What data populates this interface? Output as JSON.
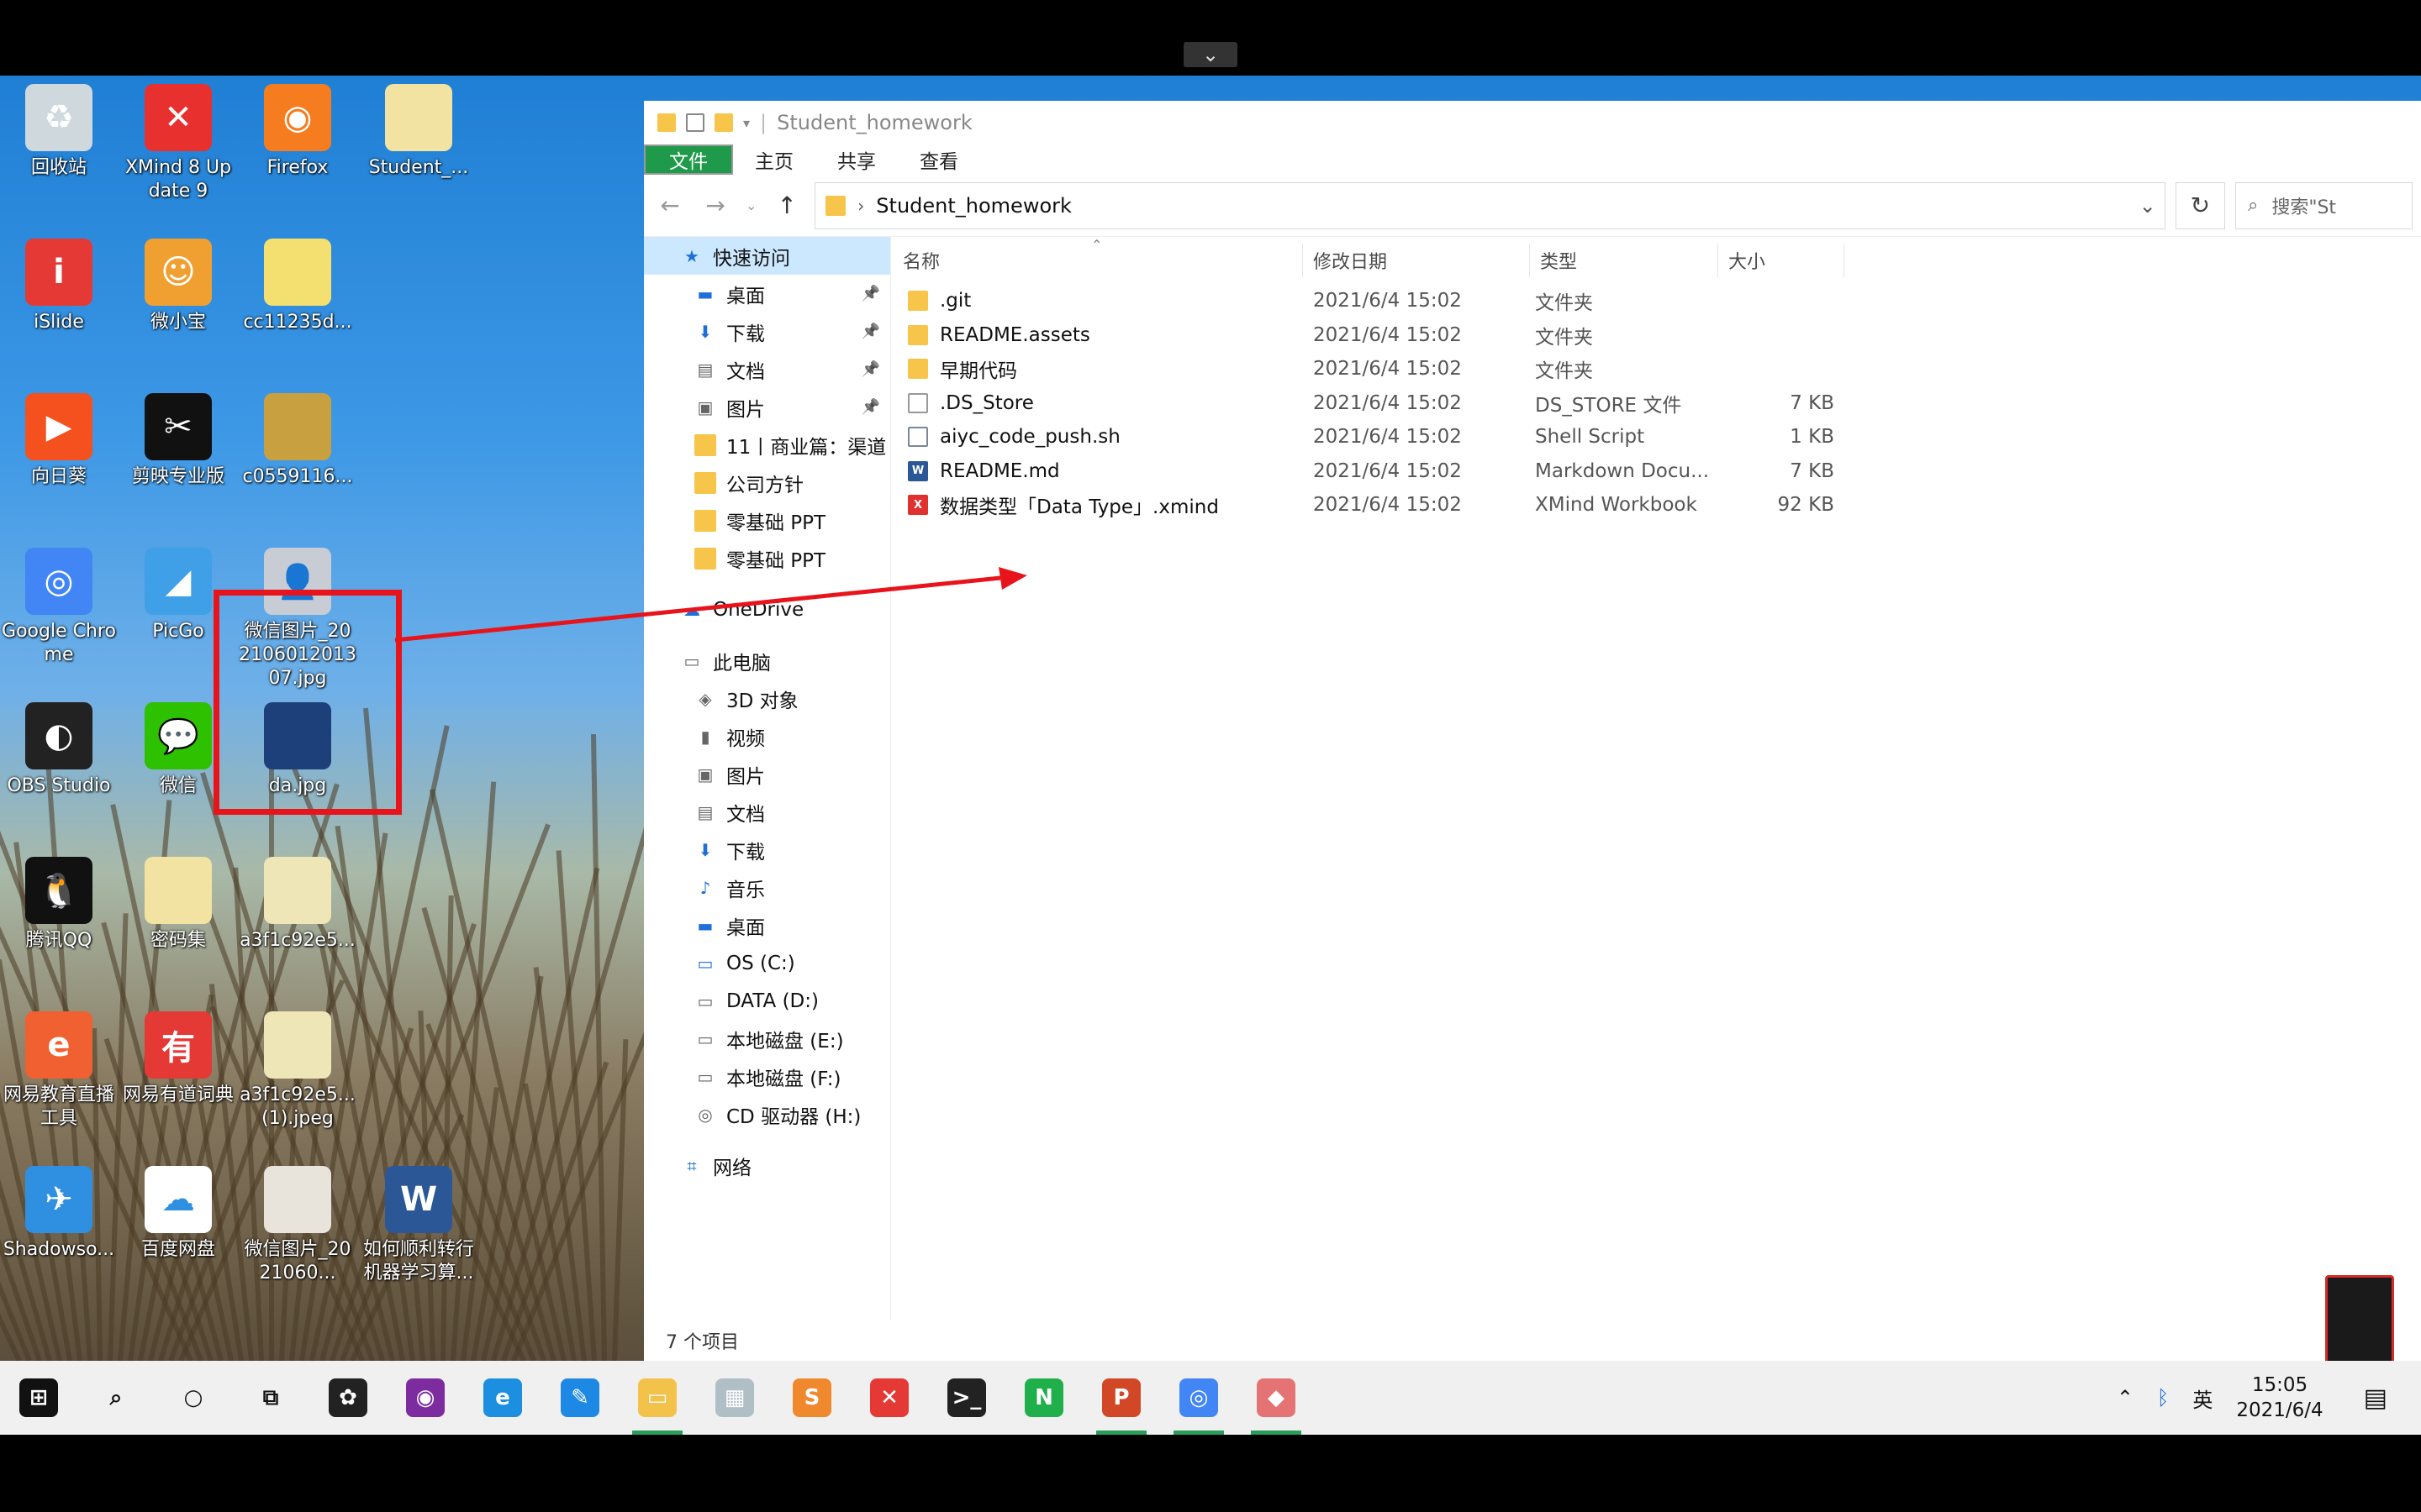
{
  "top_toggle_icon": "chevron-down-icon",
  "desktop": {
    "icons": [
      {
        "label": "回收站",
        "icon": "recycle-bin-icon",
        "color": "#cfd8dc",
        "glyph": "♻"
      },
      {
        "label": "XMind 8 Update 9",
        "icon": "xmind-icon",
        "color": "#e8312f",
        "glyph": "✕"
      },
      {
        "label": "Firefox",
        "icon": "firefox-icon",
        "color": "#f57c1f",
        "glyph": "◉"
      },
      {
        "label": "Student_...",
        "icon": "folder-icon",
        "color": "#f3e3a2",
        "glyph": ""
      },
      {
        "label": "iSlide",
        "icon": "islide-icon",
        "color": "#e53935",
        "glyph": "i"
      },
      {
        "label": "微小宝",
        "icon": "weixiaobao-icon",
        "color": "#f0a030",
        "glyph": "☺"
      },
      {
        "label": "cc11235d...",
        "icon": "zip-file-icon",
        "color": "#f3e070",
        "glyph": ""
      },
      {
        "label": "向日葵",
        "icon": "sunflower-icon",
        "color": "#f4511e",
        "glyph": "▶"
      },
      {
        "label": "剪映专业版",
        "icon": "jianying-icon",
        "color": "#111111",
        "glyph": "✂"
      },
      {
        "label": "c0559116...",
        "icon": "image-file-icon",
        "color": "#c9a040",
        "glyph": ""
      },
      {
        "label": "Google Chrome",
        "icon": "chrome-icon",
        "color": "#4285f4",
        "glyph": "◎"
      },
      {
        "label": "PicGo",
        "icon": "picgo-icon",
        "color": "#3fa0e8",
        "glyph": "◢"
      },
      {
        "label": "微信图片_20210601201307.jpg",
        "icon": "photo-file-icon",
        "color": "#c8ccd4",
        "glyph": "👤"
      },
      {
        "label": "OBS Studio",
        "icon": "obs-icon",
        "color": "#222222",
        "glyph": "◐"
      },
      {
        "label": "微信",
        "icon": "wechat-icon",
        "color": "#2dc100",
        "glyph": "💬"
      },
      {
        "label": "da.jpg",
        "icon": "image-file-icon",
        "color": "#1d3f7a",
        "glyph": ""
      },
      {
        "label": "腾讯QQ",
        "icon": "qq-icon",
        "color": "#111111",
        "glyph": "🐧"
      },
      {
        "label": "密码集",
        "icon": "folder-icon",
        "color": "#f3e3a2",
        "glyph": ""
      },
      {
        "label": "a3f1c92e5...",
        "icon": "zip-file-icon",
        "color": "#efe6b8",
        "glyph": ""
      },
      {
        "label": "网易教育直播工具",
        "icon": "edu-icon",
        "color": "#f06030",
        "glyph": "e"
      },
      {
        "label": "网易有道词典",
        "icon": "youdao-icon",
        "color": "#e53935",
        "glyph": "有"
      },
      {
        "label": "a3f1c92e5...(1).jpeg",
        "icon": "zip-file-icon",
        "color": "#efe6b8",
        "glyph": ""
      },
      {
        "label": "Shadowso...",
        "icon": "shadowsocks-icon",
        "color": "#2f8fe0",
        "glyph": "✈"
      },
      {
        "label": "百度网盘",
        "icon": "baidu-netdisk-icon",
        "color": "#ffffff",
        "glyph": "☁"
      },
      {
        "label": "微信图片_2021060...",
        "icon": "image-file-icon",
        "color": "#e8e4dc",
        "glyph": ""
      },
      {
        "label": "如何顺利转行机器学习算...",
        "icon": "word-icon",
        "color": "#2b5797",
        "glyph": "W"
      }
    ]
  },
  "explorer": {
    "title": "Student_homework",
    "ribbon_tabs": [
      "文件",
      "主页",
      "共享",
      "查看"
    ],
    "address": "Student_homework",
    "search_placeholder": "搜索\"St",
    "columns": [
      "名称",
      "修改日期",
      "类型",
      "大小"
    ],
    "files": [
      {
        "name": ".git",
        "date": "2021/6/4 15:02",
        "type": "文件夹",
        "size": "",
        "kind": "folder"
      },
      {
        "name": "README.assets",
        "date": "2021/6/4 15:02",
        "type": "文件夹",
        "size": "",
        "kind": "folder"
      },
      {
        "name": "早期代码",
        "date": "2021/6/4 15:02",
        "type": "文件夹",
        "size": "",
        "kind": "folder"
      },
      {
        "name": ".DS_Store",
        "date": "2021/6/4 15:02",
        "type": "DS_STORE 文件",
        "size": "7 KB",
        "kind": "file"
      },
      {
        "name": "aiyc_code_push.sh",
        "date": "2021/6/4 15:02",
        "type": "Shell Script",
        "size": "1 KB",
        "kind": "sh"
      },
      {
        "name": "README.md",
        "date": "2021/6/4 15:02",
        "type": "Markdown Docu...",
        "size": "7 KB",
        "kind": "word"
      },
      {
        "name": "数据类型「Data Type」.xmind",
        "date": "2021/6/4 15:02",
        "type": "XMind Workbook",
        "size": "92 KB",
        "kind": "xmind"
      }
    ],
    "nav": [
      {
        "label": "快速访问",
        "icon": "star-icon",
        "level": 0,
        "pinned": false,
        "selected": true
      },
      {
        "label": "桌面",
        "icon": "desktop-icon",
        "level": 1,
        "pinned": true
      },
      {
        "label": "下载",
        "icon": "download-icon",
        "level": 1,
        "pinned": true
      },
      {
        "label": "文档",
        "icon": "document-icon",
        "level": 1,
        "pinned": true
      },
      {
        "label": "图片",
        "icon": "pictures-icon",
        "level": 1,
        "pinned": true
      },
      {
        "label": "11丨商业篇：渠道",
        "icon": "folder-icon",
        "level": 1,
        "pinned": false
      },
      {
        "label": "公司方针",
        "icon": "folder-icon",
        "level": 1,
        "pinned": false
      },
      {
        "label": "零基础 PPT",
        "icon": "folder-icon",
        "level": 1,
        "pinned": false
      },
      {
        "label": "零基础 PPT",
        "icon": "folder-icon",
        "level": 1,
        "pinned": false
      },
      {
        "label": "",
        "icon": "",
        "level": -1
      },
      {
        "label": "OneDrive",
        "icon": "onedrive-icon",
        "level": 0,
        "pinned": false
      },
      {
        "label": "",
        "icon": "",
        "level": -1
      },
      {
        "label": "此电脑",
        "icon": "this-pc-icon",
        "level": 0,
        "pinned": false
      },
      {
        "label": "3D 对象",
        "icon": "3d-objects-icon",
        "level": 1
      },
      {
        "label": "视频",
        "icon": "video-icon",
        "level": 1
      },
      {
        "label": "图片",
        "icon": "pictures-icon",
        "level": 1
      },
      {
        "label": "文档",
        "icon": "document-icon",
        "level": 1
      },
      {
        "label": "下载",
        "icon": "download-icon",
        "level": 1
      },
      {
        "label": "音乐",
        "icon": "music-icon",
        "level": 1
      },
      {
        "label": "桌面",
        "icon": "desktop-icon",
        "level": 1
      },
      {
        "label": "OS (C:)",
        "icon": "os-drive-icon",
        "level": 1
      },
      {
        "label": "DATA (D:)",
        "icon": "drive-icon",
        "level": 1
      },
      {
        "label": "本地磁盘 (E:)",
        "icon": "drive-icon",
        "level": 1
      },
      {
        "label": "本地磁盘 (F:)",
        "icon": "drive-icon",
        "level": 1
      },
      {
        "label": "CD 驱动器 (H:)",
        "icon": "cd-drive-icon",
        "level": 1
      },
      {
        "label": "",
        "icon": "",
        "level": -1
      },
      {
        "label": "网络",
        "icon": "network-icon",
        "level": 0
      }
    ],
    "status": "7 个项目"
  },
  "taskbar": {
    "apps": [
      {
        "name": "start-icon",
        "color": "#111111",
        "glyph": "⊞",
        "running": false
      },
      {
        "name": "search-icon",
        "color": "#f0f0f0",
        "glyph": "⌕",
        "running": false
      },
      {
        "name": "cortana-icon",
        "color": "#f0f0f0",
        "glyph": "○",
        "running": false
      },
      {
        "name": "task-view-icon",
        "color": "#f0f0f0",
        "glyph": "⧉",
        "running": false
      },
      {
        "name": "pinwheel-app-icon",
        "color": "#222222",
        "glyph": "✿",
        "running": false
      },
      {
        "name": "tor-browser-icon",
        "color": "#7d2ca0",
        "glyph": "◉",
        "running": false
      },
      {
        "name": "ie-icon",
        "color": "#1d8fe0",
        "glyph": "e",
        "running": false
      },
      {
        "name": "feather-app-icon",
        "color": "#1e88e5",
        "glyph": "✎",
        "running": false
      },
      {
        "name": "file-explorer-icon",
        "color": "#f3c24b",
        "glyph": "▭",
        "running": true
      },
      {
        "name": "photo-viewer-icon",
        "color": "#b0bec5",
        "glyph": "▦",
        "running": false
      },
      {
        "name": "sublime-icon",
        "color": "#f0892e",
        "glyph": "S",
        "running": false
      },
      {
        "name": "xmind-taskbar-icon",
        "color": "#e53935",
        "glyph": "✕",
        "running": false
      },
      {
        "name": "terminal-icon",
        "color": "#222222",
        "glyph": ">_",
        "running": false
      },
      {
        "name": "evernote-green-icon",
        "color": "#20b04b",
        "glyph": "N",
        "running": false
      },
      {
        "name": "powerpoint-icon",
        "color": "#d24726",
        "glyph": "P",
        "running": true
      },
      {
        "name": "chrome-taskbar-icon",
        "color": "#4285f4",
        "glyph": "◎",
        "running": true
      },
      {
        "name": "diamond-app-icon",
        "color": "#e57373",
        "glyph": "◆",
        "running": true
      }
    ],
    "tray": {
      "ime": "英",
      "time": "15:05",
      "date": "2021/6/4"
    }
  }
}
